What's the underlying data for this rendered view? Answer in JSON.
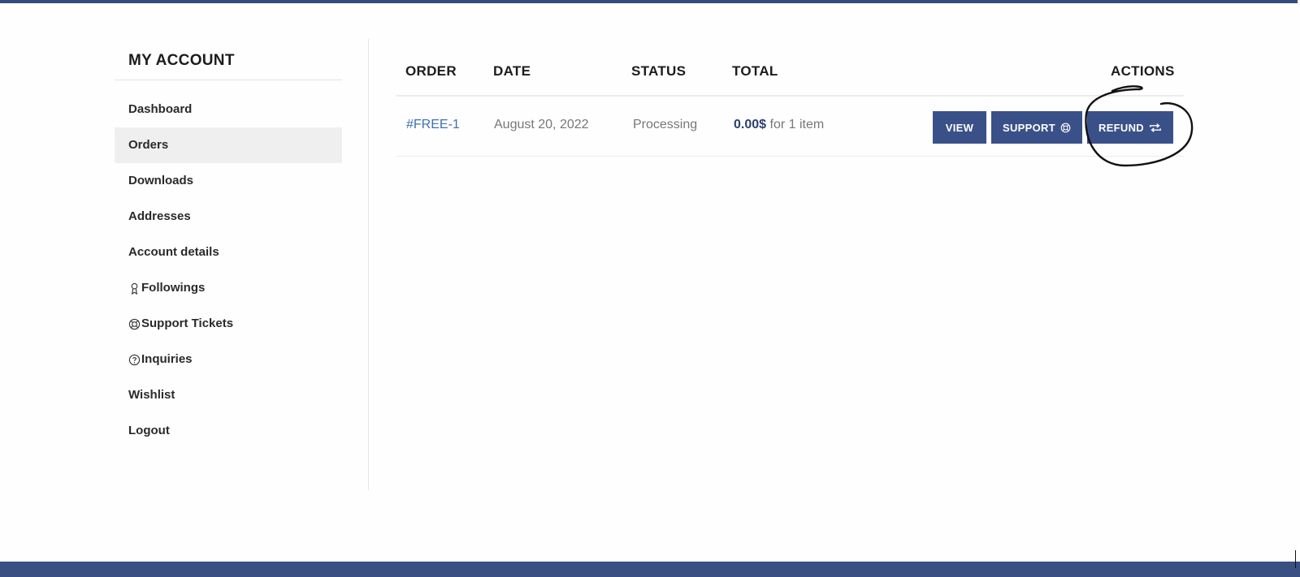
{
  "account": {
    "title": "MY ACCOUNT",
    "nav": [
      {
        "label": "Dashboard",
        "icon": "",
        "active": false
      },
      {
        "label": "Orders",
        "icon": "",
        "active": true
      },
      {
        "label": "Downloads",
        "icon": "",
        "active": false
      },
      {
        "label": "Addresses",
        "icon": "",
        "active": false
      },
      {
        "label": "Account details",
        "icon": "",
        "active": false
      },
      {
        "label": "Followings",
        "icon": "badge-icon",
        "active": false
      },
      {
        "label": "Support Tickets",
        "icon": "lifebuoy-icon",
        "active": false
      },
      {
        "label": "Inquiries",
        "icon": "question-circle-icon",
        "active": false
      },
      {
        "label": "Wishlist",
        "icon": "",
        "active": false
      },
      {
        "label": "Logout",
        "icon": "",
        "active": false
      }
    ]
  },
  "orders": {
    "headers": {
      "order": "ORDER",
      "date": "DATE",
      "status": "STATUS",
      "total": "TOTAL",
      "actions": "ACTIONS"
    },
    "rows": [
      {
        "order": "#FREE-1",
        "date": "August 20, 2022",
        "status": "Processing",
        "total_amount": "0.00$",
        "total_suffix": " for 1 item",
        "actions": {
          "view": "VIEW",
          "support": "SUPPORT",
          "support_icon": "lifebuoy-icon",
          "refund": "REFUND",
          "refund_icon": "repeat-icon"
        }
      }
    ]
  },
  "colors": {
    "accent": "#3a5088",
    "link": "#3e70b5",
    "active_bg": "#efefef"
  }
}
